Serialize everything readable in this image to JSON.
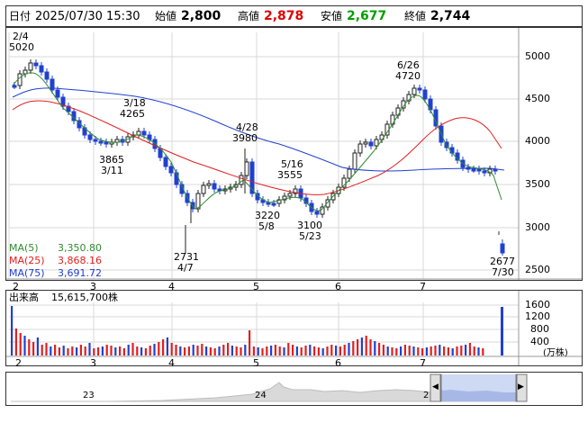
{
  "header": {
    "label_date": "日付",
    "date_time": "2025/07/30 15:30",
    "label_open": "始値",
    "open": "2,800",
    "label_high": "高値",
    "high": "2,878",
    "label_low": "安値",
    "low": "2,677",
    "label_close": "終値",
    "close": "2,744",
    "colors": {
      "high": "#e00000",
      "low": "#00a000"
    }
  },
  "price_chart": {
    "y_ticks": [
      "5000",
      "4500",
      "4000",
      "3500",
      "3000",
      "2500"
    ],
    "x_ticks": [
      "2",
      "3",
      "4",
      "5",
      "6",
      "7"
    ],
    "moving_averages": [
      {
        "label": "MA(5)",
        "value": "3,350.80",
        "color": "#2e8b2e"
      },
      {
        "label": "MA(25)",
        "value": "3,868.16",
        "color": "#e02020"
      },
      {
        "label": "MA(75)",
        "value": "3,691.72",
        "color": "#2040d0"
      }
    ],
    "annotations": [
      {
        "top": "2/4",
        "bottom": "5020"
      },
      {
        "top": "3/18",
        "bottom": "4265"
      },
      {
        "top": "3865",
        "bottom": "3/11"
      },
      {
        "top": "4/28",
        "bottom": "3980"
      },
      {
        "top": "5/16",
        "bottom": "3555"
      },
      {
        "top": "3220",
        "bottom": "5/8"
      },
      {
        "top": "3100",
        "bottom": "5/23"
      },
      {
        "top": "2731",
        "bottom": "4/7"
      },
      {
        "top": "6/26",
        "bottom": "4720"
      },
      {
        "top": "2677",
        "bottom": "7/30"
      }
    ]
  },
  "volume_chart": {
    "title": "出来高",
    "value": "15,615,700株",
    "y_ticks": [
      "1600",
      "1200",
      "800",
      "400"
    ],
    "unit": "(万株)",
    "x_ticks": [
      "2",
      "3",
      "4",
      "5",
      "6",
      "7"
    ]
  },
  "navigator": {
    "labels": [
      "23",
      "24",
      "2"
    ],
    "left_arrow": "◀",
    "right_arrow": "▶"
  }
}
